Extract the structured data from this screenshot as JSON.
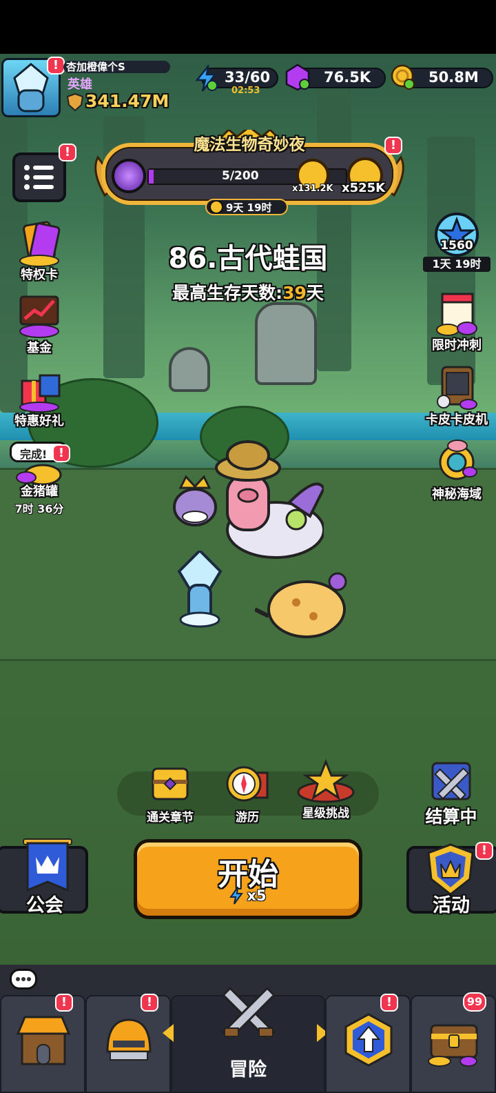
{
  "player": {
    "name": "杏加橙偉个S",
    "rank": "英雄",
    "power": "341.47M"
  },
  "resources": {
    "energy": "33/60",
    "energy_timer": "02:53",
    "gems": "76.5K",
    "gold": "50.8M"
  },
  "event": {
    "title": "魔法生物奇妙夜",
    "progress": "5/200",
    "progress_fraction": 0.025,
    "reward_small": "x131.2K",
    "reward_big": "x525K",
    "timer": "9天 19时"
  },
  "stage": {
    "title": "86.古代蛙国",
    "survival_prefix": "最高生存天数:",
    "survival_days": "39",
    "survival_suffix": "天"
  },
  "left_menu": [
    {
      "label": "特权卡",
      "icon": "privilege-card-icon"
    },
    {
      "label": "基金",
      "icon": "fund-chart-icon"
    },
    {
      "label": "特惠好礼",
      "icon": "gift-box-icon"
    },
    {
      "label": "金猪罐",
      "icon": "gold-pig-icon",
      "bubble": "完成!",
      "timer": "7时 36分"
    }
  ],
  "right_menu": [
    {
      "label": "1560",
      "sub": "1天 19时",
      "icon": "star-medal-icon"
    },
    {
      "label": "限时冲刺",
      "icon": "calendar-icon"
    },
    {
      "label": "卡皮卡皮机",
      "icon": "slot-machine-icon"
    },
    {
      "label": "神秘海域",
      "icon": "mystic-sea-icon"
    }
  ],
  "mid_actions": [
    {
      "label": "通关章节",
      "icon": "chapter-chest-icon"
    },
    {
      "label": "游历",
      "icon": "compass-icon"
    },
    {
      "label": "星级挑战",
      "icon": "star-challenge-icon"
    }
  ],
  "settlement_label": "结算中",
  "guild_label": "公会",
  "activity_label": "活动",
  "start": {
    "label": "开始",
    "cost": "x5"
  },
  "nav": {
    "battle_label": "冒险",
    "chest_badge": "99"
  },
  "badge_mark": "!",
  "colors": {
    "accent_orange": "#f7a21b",
    "badge_red": "#f2354f",
    "gem_purple": "#b43cf0",
    "gold": "#f5c02c"
  }
}
